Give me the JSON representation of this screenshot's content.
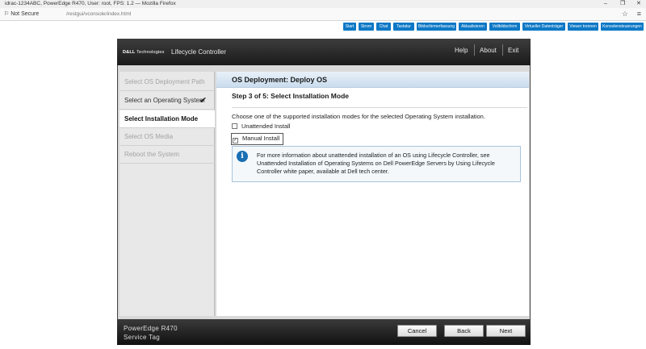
{
  "browser": {
    "title": "idrac-1234ABC, PowerEdge R470, User: root, FPS: 1.2 — Mozilla Firefox",
    "security_label": "Not Secure",
    "url": "/restgui/vconsole/index.html"
  },
  "viewer_toolbar": [
    {
      "label": "Start"
    },
    {
      "label": "Strom"
    },
    {
      "label": "Chat"
    },
    {
      "label": "Tastatur"
    },
    {
      "label": "Bildschirmerfassung"
    },
    {
      "label": "Aktualisieren"
    },
    {
      "label": "Vollbildschirm"
    },
    {
      "label": "Virtueller Datenträger"
    },
    {
      "label": "Viewer trennen"
    },
    {
      "label": "Konsolensteuerungen"
    }
  ],
  "lc": {
    "logo_brand": "D&LL",
    "logo_sub": "Technologies",
    "title": "Lifecycle Controller",
    "help": "Help",
    "about": "About",
    "exit": "Exit"
  },
  "nav": [
    {
      "label": "Select OS Deployment Path"
    },
    {
      "label": "Select an Operating System"
    },
    {
      "label": "Select Installation Mode"
    },
    {
      "label": "Select OS Media"
    },
    {
      "label": "Reboot the System"
    }
  ],
  "main": {
    "header": "OS Deployment: Deploy OS",
    "step_title": "Step 3 of 5: Select Installation Mode",
    "description": "Choose one of the supported installation modes for the selected Operating System installation.",
    "options": [
      {
        "label": "Unattended Install",
        "checked": false
      },
      {
        "label": "Manual Install",
        "checked": true
      }
    ],
    "info_text": "For more information about unattended installation of an OS using Lifecycle Controller, see Unattended Installation of Operating Systems on Dell PowerEdge Servers by Using Lifecycle Controller white paper, available at Dell tech center."
  },
  "footer": {
    "model": "PowerEdge R470",
    "service_tag": "Service Tag",
    "cancel": "Cancel",
    "back": "Back",
    "next": "Next"
  }
}
